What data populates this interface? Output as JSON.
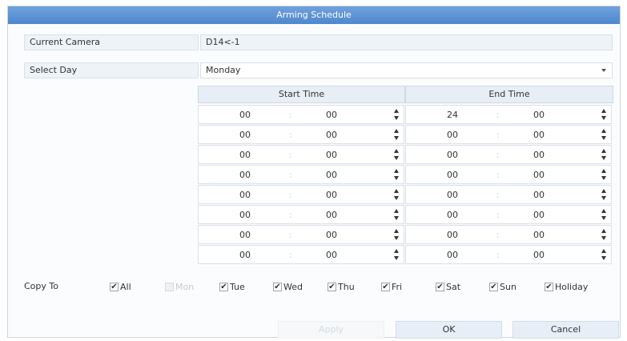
{
  "dialog": {
    "title": "Arming Schedule"
  },
  "camera": {
    "label": "Current Camera",
    "value": "D14<-1"
  },
  "day": {
    "label": "Select Day",
    "value": "Monday"
  },
  "schedule": {
    "start_header": "Start Time",
    "end_header": "End Time",
    "separator": ":",
    "rows": [
      {
        "start_h": "00",
        "start_m": "00",
        "end_h": "24",
        "end_m": "00"
      },
      {
        "start_h": "00",
        "start_m": "00",
        "end_h": "00",
        "end_m": "00"
      },
      {
        "start_h": "00",
        "start_m": "00",
        "end_h": "00",
        "end_m": "00"
      },
      {
        "start_h": "00",
        "start_m": "00",
        "end_h": "00",
        "end_m": "00"
      },
      {
        "start_h": "00",
        "start_m": "00",
        "end_h": "00",
        "end_m": "00"
      },
      {
        "start_h": "00",
        "start_m": "00",
        "end_h": "00",
        "end_m": "00"
      },
      {
        "start_h": "00",
        "start_m": "00",
        "end_h": "00",
        "end_m": "00"
      },
      {
        "start_h": "00",
        "start_m": "00",
        "end_h": "00",
        "end_m": "00"
      }
    ]
  },
  "copy_to": {
    "label": "Copy To",
    "check_glyph": "✔",
    "options": [
      {
        "label": "All",
        "checked": true,
        "enabled": true
      },
      {
        "label": "Mon",
        "checked": false,
        "enabled": false
      },
      {
        "label": "Tue",
        "checked": true,
        "enabled": true
      },
      {
        "label": "Wed",
        "checked": true,
        "enabled": true
      },
      {
        "label": "Thu",
        "checked": true,
        "enabled": true
      },
      {
        "label": "Fri",
        "checked": true,
        "enabled": true
      },
      {
        "label": "Sat",
        "checked": true,
        "enabled": true
      },
      {
        "label": "Sun",
        "checked": true,
        "enabled": true
      },
      {
        "label": "Holiday",
        "checked": true,
        "enabled": true
      }
    ]
  },
  "buttons": {
    "apply": "Apply",
    "ok": "OK",
    "cancel": "Cancel"
  }
}
